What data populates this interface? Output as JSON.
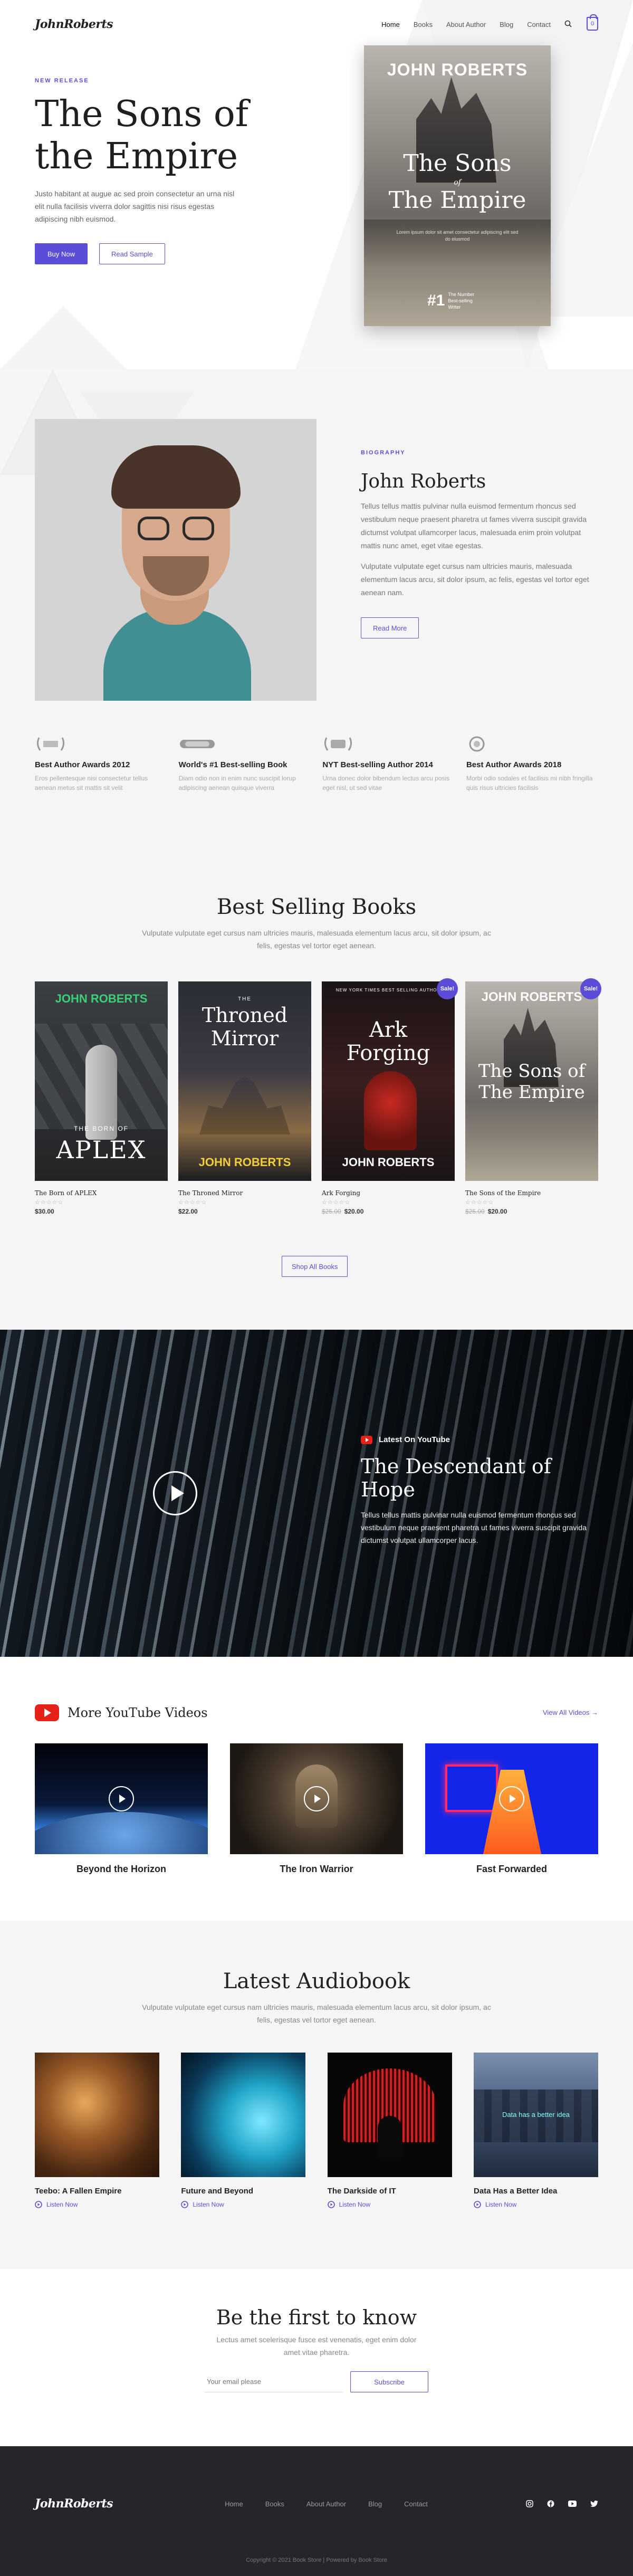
{
  "header": {
    "logo": "JohnRoberts",
    "nav": [
      "Home",
      "Books",
      "About Author",
      "Blog",
      "Contact"
    ],
    "cart_count": "0"
  },
  "hero": {
    "eyebrow": "NEW RELEASE",
    "title": "The Sons of the Empire",
    "text": "Justo habitant at augue ac sed proin consectetur an urna nisl elit nulla facilisis viverra dolor sagittis nisi risus egestas adipiscing nibh euismod.",
    "buy_label": "Buy Now",
    "sample_label": "Read Sample",
    "cover": {
      "author": "JOHN ROBERTS",
      "title_line1": "The Sons",
      "title_of": "of",
      "title_line2": "The Empire",
      "tagline": "Lorem ipsum dolor sit amet consectetur adipiscing elit sed do eiusmod",
      "badge_num": "#1",
      "badge_text": "The Number Best-selling Writer"
    }
  },
  "bio": {
    "eyebrow": "BIOGRAPHY",
    "name": "John Roberts",
    "p1": "Tellus tellus mattis pulvinar nulla euismod fermentum rhoncus sed vestibulum neque praesent pharetra ut fames viverra suscipit gravida dictumst volutpat ullamcorper lacus, malesuada enim proin volutpat mattis nunc amet, eget vitae egestas.",
    "p2": "Vulputate vulputate eget cursus nam ultricies mauris, malesuada elementum lacus arcu, sit dolor ipsum, ac felis, egestas vel tortor eget aenean nam.",
    "read_more": "Read More"
  },
  "awards": [
    {
      "title": "Best Author Awards 2012",
      "text": "Eros pellentesque nisi consectetur tellus aenean metus sit mattis sit velit"
    },
    {
      "title": "World's #1 Best-selling Book",
      "text": "Diam odio non in enim nunc suscipit lorup adipiscing aenean quisque viverra"
    },
    {
      "title": "NYT Best-selling Author 2014",
      "text": "Urna donec dolor bibendum lectus arcu posis eget nisl, ut sed vitae"
    },
    {
      "title": "Best Author Awards 2018",
      "text": "Morbi odio sodales et facilisis mi nibh fringilla quis risus ultricies facilisis"
    }
  ],
  "best_selling": {
    "title": "Best Selling Books",
    "sub": "Vulputate vulputate eget cursus nam ultricies mauris, malesuada elementum lacus arcu, sit dolor ipsum, ac felis, egestas vel tortor eget aenean.",
    "shop_all": "Shop All Books",
    "sale_label": "Sale!",
    "books": [
      {
        "name": "The Born of APLEX",
        "price": "$30.00",
        "old_price": "",
        "cover_author": "JOHN ROBERTS",
        "cover_title": "APLEX",
        "cover_small": "THE BORN OF",
        "sale": false
      },
      {
        "name": "The Throned Mirror",
        "price": "$22.00",
        "old_price": "",
        "cover_author": "JOHN ROBERTS",
        "cover_title": "Throned Mirror",
        "cover_small": "THE",
        "sale": false
      },
      {
        "name": "Ark Forging",
        "price": "$20.00",
        "old_price": "$25.00",
        "cover_author": "JOHN ROBERTS",
        "cover_title": "Ark Forging",
        "cover_small": "NEW YORK TIMES BEST SELLING AUTHOR",
        "sale": true
      },
      {
        "name": "The Sons of the Empire",
        "price": "$20.00",
        "old_price": "$25.00",
        "cover_author": "JOHN ROBERTS",
        "cover_title": "The Sons of The Empire",
        "cover_small": "",
        "sale": true
      }
    ]
  },
  "youtube": {
    "label": "Latest On YouTube",
    "title": "The Descendant of Hope",
    "text": "Tellus tellus mattis pulvinar nulla euismod fermentum rhoncus sed vestibulum neque praesent pharetra ut fames viverra suscipit gravida dictumst volutpat ullamcorper lacus."
  },
  "more_videos": {
    "title": "More YouTube Videos",
    "view_all": "View All Videos →",
    "videos": [
      {
        "title": "Beyond the Horizon"
      },
      {
        "title": "The Iron Warrior"
      },
      {
        "title": "Fast Forwarded"
      }
    ]
  },
  "audiobook": {
    "title": "Latest Audiobook",
    "sub": "Vulputate vulputate eget cursus nam ultricies mauris, malesuada elementum lacus arcu, sit dolor ipsum, ac felis, egestas vel tortor eget aenean.",
    "listen": "Listen Now",
    "items": [
      {
        "title": "Teebo: A Fallen Empire"
      },
      {
        "title": "Future and Beyond"
      },
      {
        "title": "The Darkside of IT"
      },
      {
        "title": "Data Has a Better Idea",
        "cover_text": "Data has a better idea"
      }
    ]
  },
  "newsletter": {
    "title": "Be the first to know",
    "text": "Lectus amet scelerisque fusce est venenatis, eget enim dolor amet vitae pharetra.",
    "placeholder": "Your email please",
    "button": "Subscribe"
  },
  "footer": {
    "logo": "JohnRoberts",
    "nav": [
      "Home",
      "Books",
      "About Author",
      "Blog",
      "Contact"
    ],
    "copyright": "Copyright © 2021 Book Store | Powered by Book Store"
  },
  "colors": {
    "accent": "#5b4dd8",
    "youtube_red": "#e62117",
    "footer_bg": "#25262b"
  }
}
